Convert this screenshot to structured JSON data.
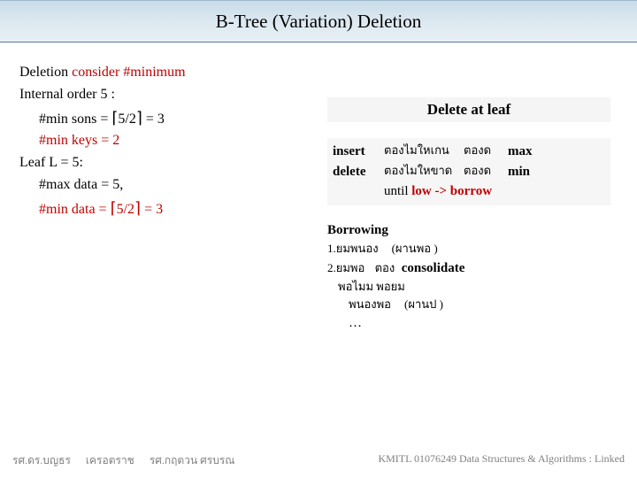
{
  "title": "B-Tree (Variation) Deletion",
  "left": {
    "l1a": "Deletion ",
    "l1b": "consider #minimum",
    "l2": "Internal order 5 : ",
    "l3a": "#min sons = ",
    "l3b": "5/2",
    "l3c": " = 3",
    "l4": "#min keys = 2",
    "l5": "Leaf L = 5:",
    "l6": "#max data = 5,",
    "l7a": "#min data = ",
    "l7b": "5/2",
    "l7c": " = 3"
  },
  "right": {
    "header_a": "Delete",
    "header_b": "at leaf",
    "r1_c1": "insert",
    "r1_c2": "ตองไมใหเกน",
    "r1_c3": "ตองด",
    "r1_c4": "max",
    "r2_c1": "delete",
    "r2_c2": "ตองไมใหขาด",
    "r2_c3": "ตองด",
    "r2_c4": "min",
    "r3a": "until ",
    "r3b": "low -> borrow"
  },
  "borrowing": {
    "title": "Borrowing",
    "l1a": "1.ยมพนอง",
    "l1b": "(ผานพอ   )",
    "l2a": "2.ยมพอ",
    "l2b": "ตอง",
    "l2c": "consolidate",
    "l3": "พอไมม       พอยม",
    "l4a": "พนองพอ",
    "l4b": "(ผานป     )",
    "l5": "…"
  },
  "footer": {
    "a": "รศ.ดร.บญธร",
    "b": "เครอตราช",
    "c": "รศ.กฤตวน ศรบรณ",
    "right": "KMITL 01076249 Data Structures & Algorithms : Linked"
  }
}
